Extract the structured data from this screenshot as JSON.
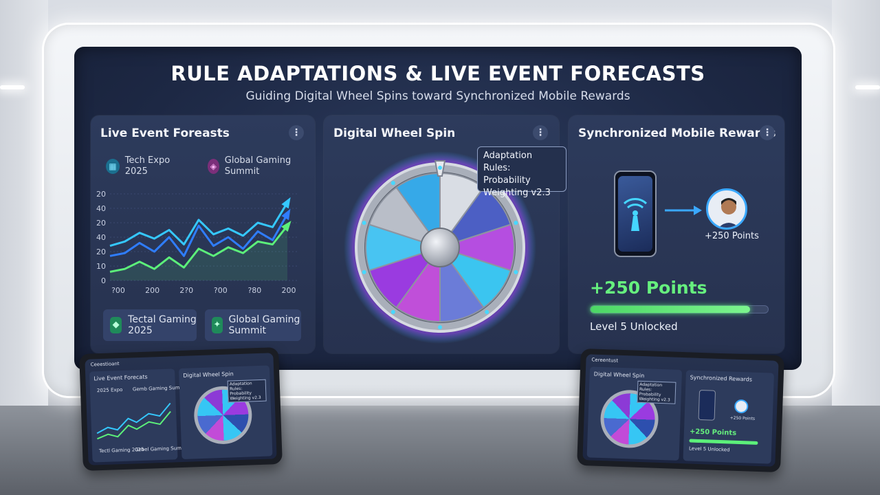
{
  "screen": {
    "title": "RULE ADAPTATIONS & LIVE EVENT FORECASTS",
    "subtitle": "Guiding Digital Wheel Spins toward Synchronized Mobile Rewards"
  },
  "forecast_panel": {
    "title": "Live Event Foreasts",
    "menu_icon": "kebab-icon",
    "top_events": [
      {
        "label": "Tech Expo 2025",
        "icon": "calendar-icon",
        "color": "#2bb0d6"
      },
      {
        "label": "Global Gaming Summit",
        "icon": "gamepad-icon",
        "color": "#d14fc7"
      }
    ],
    "bottom_events": [
      {
        "label": "Tectal Gaming 2025",
        "icon": "gamepad-icon"
      },
      {
        "label": "Global Gaming Summit",
        "icon": "controller-icon"
      }
    ]
  },
  "chart_data": {
    "type": "line",
    "x": [
      "?00",
      "200",
      "2?0",
      "?00",
      "?80",
      "200"
    ],
    "xlabel": "",
    "ylabel": "",
    "y_ticks": [
      "0",
      "10",
      "20",
      "40",
      "20",
      "40",
      "20"
    ],
    "series": [
      {
        "color": "#35c8ff",
        "values": [
          24,
          27,
          33,
          29,
          35,
          25,
          42,
          32,
          36,
          31,
          40,
          37,
          54
        ]
      },
      {
        "color": "#2f7dff",
        "values": [
          17,
          19,
          26,
          20,
          30,
          17,
          38,
          24,
          30,
          22,
          34,
          28,
          46
        ]
      },
      {
        "color": "#5cf07a",
        "values": [
          6,
          8,
          13,
          8,
          16,
          9,
          22,
          17,
          23,
          19,
          27,
          25,
          38
        ]
      }
    ],
    "ylim": [
      0,
      60
    ],
    "grid": true
  },
  "wheel_panel": {
    "title": "Digital Wheel Spin",
    "menu_icon": "kebab-icon",
    "tooltip": {
      "line1": "Adaptation Rules:",
      "line2": "Probability",
      "line3": "Weighting v2.3"
    }
  },
  "rewards_panel": {
    "title": "Synchronized Mobile Rewards",
    "menu_icon": "kebab-icon",
    "phone_icon": "signal-tower-icon",
    "user_points": "+250 Points",
    "points_big": "+250 Points",
    "level": "Level 5 Unlocked",
    "progress": 0.9
  },
  "tablet_left": {
    "header": "Ceeestioant",
    "panel1": "Live Event Forecats",
    "panel2": "Digital Wheel Spin",
    "ev1": "2025 Expo",
    "ev2": "Gemb Gaming Summit",
    "ev3": "Tectl Gaming 2025",
    "ev4": "Gebel Gaming Summit",
    "tooltip": "Adaptation Rules: Probability Weighting v2.3"
  },
  "tablet_right": {
    "header": "Cereentust",
    "panel1": "Digital Wheel Spin",
    "panel2": "Synchronized Rewards",
    "tooltip": "Adaptation Rules: Probability Weighting v2.3",
    "user_points": "+250 Points",
    "points_big": "+250 Points",
    "level": "Level 5 Unlocked"
  }
}
